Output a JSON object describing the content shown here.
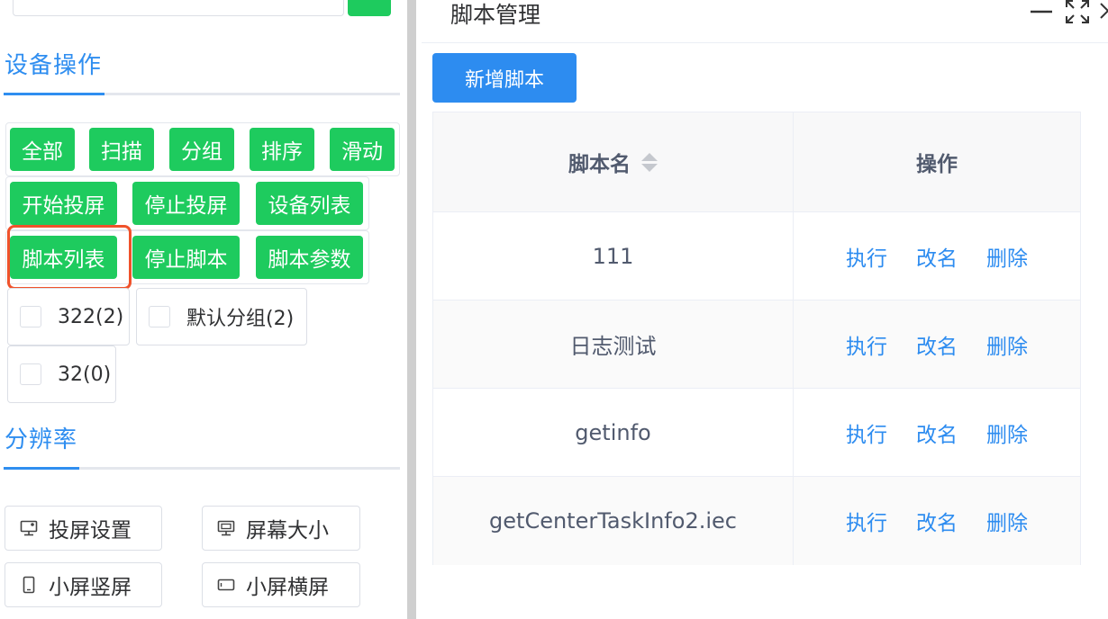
{
  "left": {
    "device_ops": {
      "title": "设备操作",
      "buttons_row1": [
        "全部",
        "扫描",
        "分组",
        "排序",
        "滑动"
      ],
      "buttons_row2": [
        "开始投屏",
        "停止投屏",
        "设备列表"
      ],
      "buttons_row3": [
        "脚本列表",
        "停止脚本",
        "脚本参数"
      ]
    },
    "groups": [
      {
        "label": "322(2)"
      },
      {
        "label": "默认分组(2)"
      },
      {
        "label": "32(0)"
      }
    ],
    "resolution": {
      "title": "分辨率",
      "buttons": [
        {
          "label": "投屏设置",
          "icon": "monitor-settings-icon"
        },
        {
          "label": "屏幕大小",
          "icon": "screen-size-icon"
        },
        {
          "label": "小屏竖屏",
          "icon": "portrait-icon"
        },
        {
          "label": "小屏横屏",
          "icon": "landscape-icon"
        }
      ]
    },
    "colors": {
      "green": "#1ecb5e",
      "blue": "#2f8ef0",
      "highlight": "#f0522b"
    }
  },
  "dialog": {
    "title": "脚本管理",
    "add_button": "新增脚本",
    "table": {
      "headers": [
        "脚本名",
        "操作"
      ],
      "actions": [
        "执行",
        "改名",
        "删除"
      ],
      "rows": [
        {
          "name": "111"
        },
        {
          "name": "日志测试"
        },
        {
          "name": "getinfo"
        },
        {
          "name": "getCenterTaskInfo2.iec"
        }
      ]
    }
  }
}
